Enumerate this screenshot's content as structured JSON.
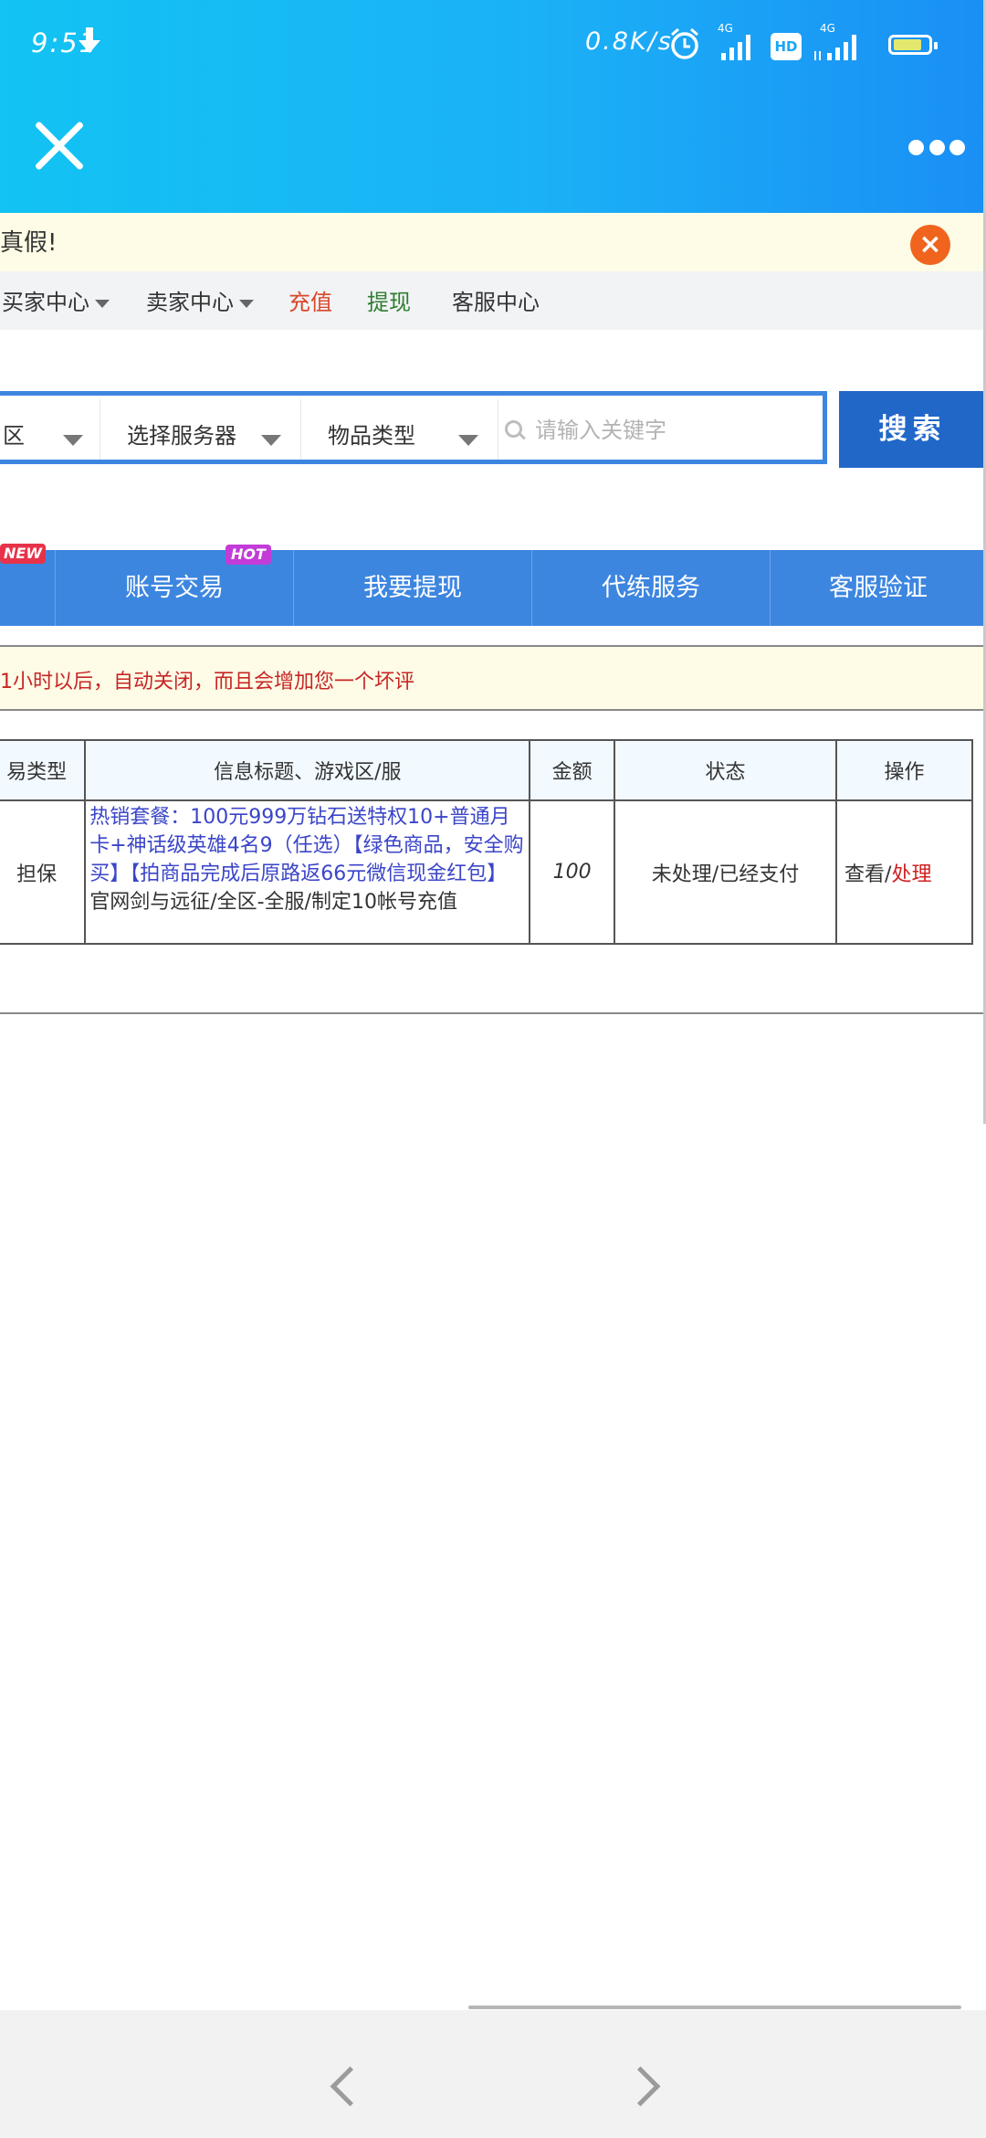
{
  "status_bar": {
    "time": "9:51",
    "net_speed": "0.8K/s",
    "net_type_1": "4G",
    "net_type_2": "4G",
    "hd": "HD"
  },
  "notice": {
    "text": "真假!",
    "close": "×"
  },
  "top_links": [
    {
      "label": "买家中心",
      "dropdown": true,
      "color": "#333333"
    },
    {
      "label": "卖家中心",
      "dropdown": true,
      "color": "#333333"
    },
    {
      "label": "充值",
      "dropdown": false,
      "color": "#d8472b"
    },
    {
      "label": "提现",
      "dropdown": false,
      "color": "#2f7d2f"
    },
    {
      "label": "客服中心",
      "dropdown": false,
      "color": "#333333"
    }
  ],
  "search": {
    "select_zone": "区",
    "select_server": "选择服务器",
    "select_item_type": "物品类型",
    "placeholder": "请输入关键字",
    "button": "搜索"
  },
  "menu": {
    "badge_new": "NEW",
    "badge_hot": "HOT",
    "items": [
      "账号交易",
      "我要提现",
      "代练服务",
      "客服验证"
    ]
  },
  "warning": "1小时以后，自动关闭，而且会增加您一个坏评",
  "table": {
    "headers": [
      "易类型",
      "信息标题、游戏区/服",
      "金额",
      "状态",
      "操作"
    ],
    "row": {
      "type": "担保",
      "title_line1": "热销套餐：100元999万钻石送特权10+普通月卡+神话级英雄4名9（任选）【绿色商品，安全购买】【拍商品完成后原路返66元微信现金红包】",
      "title_line2": "官网剑与远征/全区-全服/制定10帐号充值",
      "amount": "100",
      "status": "未处理/已经支付",
      "op_view": "查看",
      "op_sep": "/",
      "op_process": "处理"
    }
  }
}
